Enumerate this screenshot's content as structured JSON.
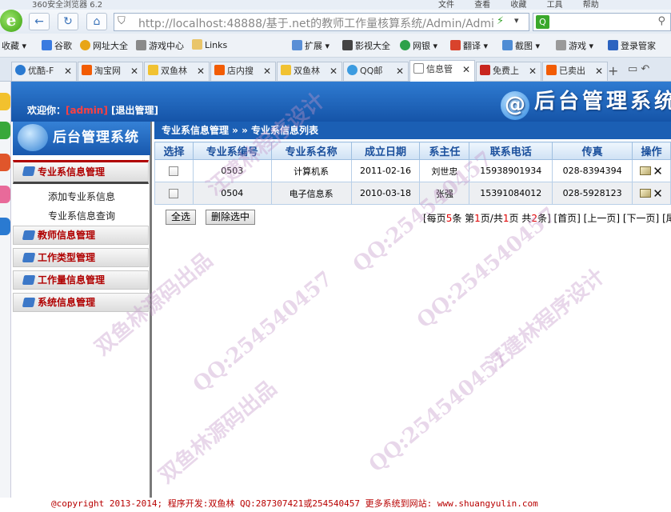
{
  "browser": {
    "title": "360安全浏览器 6.2",
    "menus": [
      "文件",
      "查看",
      "收藏",
      "工具",
      "帮助"
    ],
    "address": "http://localhost:48888/基于.net的教师工作量核算系统/Admin/Admi",
    "address_host": "localhost",
    "favorites": [
      "收藏",
      "谷歌",
      "网址大全",
      "游戏中心",
      "Links",
      "扩展",
      "影视大全",
      "网银",
      "翻译",
      "截图",
      "游戏",
      "登录管家"
    ],
    "tabs": [
      "优酷-F",
      "淘宝网",
      "双鱼林",
      "店内搜",
      "双鱼林",
      "QQ邮",
      "信息管",
      "免费上",
      "已卖出"
    ]
  },
  "header": {
    "welcome_prefix": "欢迎你：",
    "user": "[admin]",
    "logout": "[退出管理]",
    "title": "后台管理系统"
  },
  "left": {
    "logo_text": "后台管理系统",
    "menus": [
      {
        "label": "专业系信息管理",
        "subs": [
          "添加专业系信息",
          "专业系信息查询"
        ]
      },
      {
        "label": "教师信息管理"
      },
      {
        "label": "工作类型管理"
      },
      {
        "label": "工作量信息管理"
      },
      {
        "label": "系统信息管理"
      }
    ]
  },
  "content": {
    "crumb": "专业系信息管理 » » 专业系信息列表",
    "columns": [
      "选择",
      "专业系编号",
      "专业系名称",
      "成立日期",
      "系主任",
      "联系电话",
      "传真",
      "操作"
    ],
    "rows": [
      {
        "code": "0503",
        "name": "计算机系",
        "date": "2011-02-16",
        "head": "刘世忠",
        "phone": "15938901934",
        "fax": "028-8394394"
      },
      {
        "code": "0504",
        "name": "电子信息系",
        "date": "2010-03-18",
        "head": "张强",
        "phone": "15391084012",
        "fax": "028-5928123"
      }
    ],
    "select_all": "全选",
    "delete_selected": "删除选中",
    "pager": {
      "p1": "[每页",
      "per": "5",
      "p2": "条 第",
      "cur": "1",
      "p3": "页/共",
      "total": "1",
      "p4": "页 共",
      "count": "2",
      "p5": "条]",
      "first": "[首页]",
      "prev": "[上一页]",
      "next": "[下一页]",
      "last": "[尾页]"
    }
  },
  "footer": "@copyright 2013-2014; 程序开发:双鱼林  QQ:287307421或254540457  更多系统到网站: www.shuangyulin.com",
  "watermark": [
    "双鱼林源码出品",
    "QQ:254540457",
    "汪建林程序设计"
  ]
}
